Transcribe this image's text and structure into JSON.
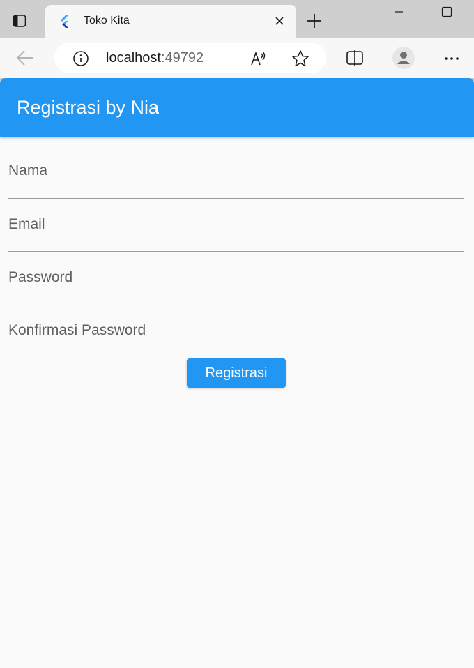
{
  "browser": {
    "tab": {
      "title": "Toko Kita"
    },
    "address_bar": {
      "host": "localhost",
      "port": ":49792"
    }
  },
  "page": {
    "appbar_title": "Registrasi by Nia",
    "fields": [
      {
        "label": "Nama"
      },
      {
        "label": "Email"
      },
      {
        "label": "Password"
      },
      {
        "label": "Konfirmasi Password"
      }
    ],
    "submit_label": "Registrasi"
  },
  "colors": {
    "primary": "#2196f3",
    "page_background": "#fafafa",
    "field_label": "#5f5f5f"
  }
}
